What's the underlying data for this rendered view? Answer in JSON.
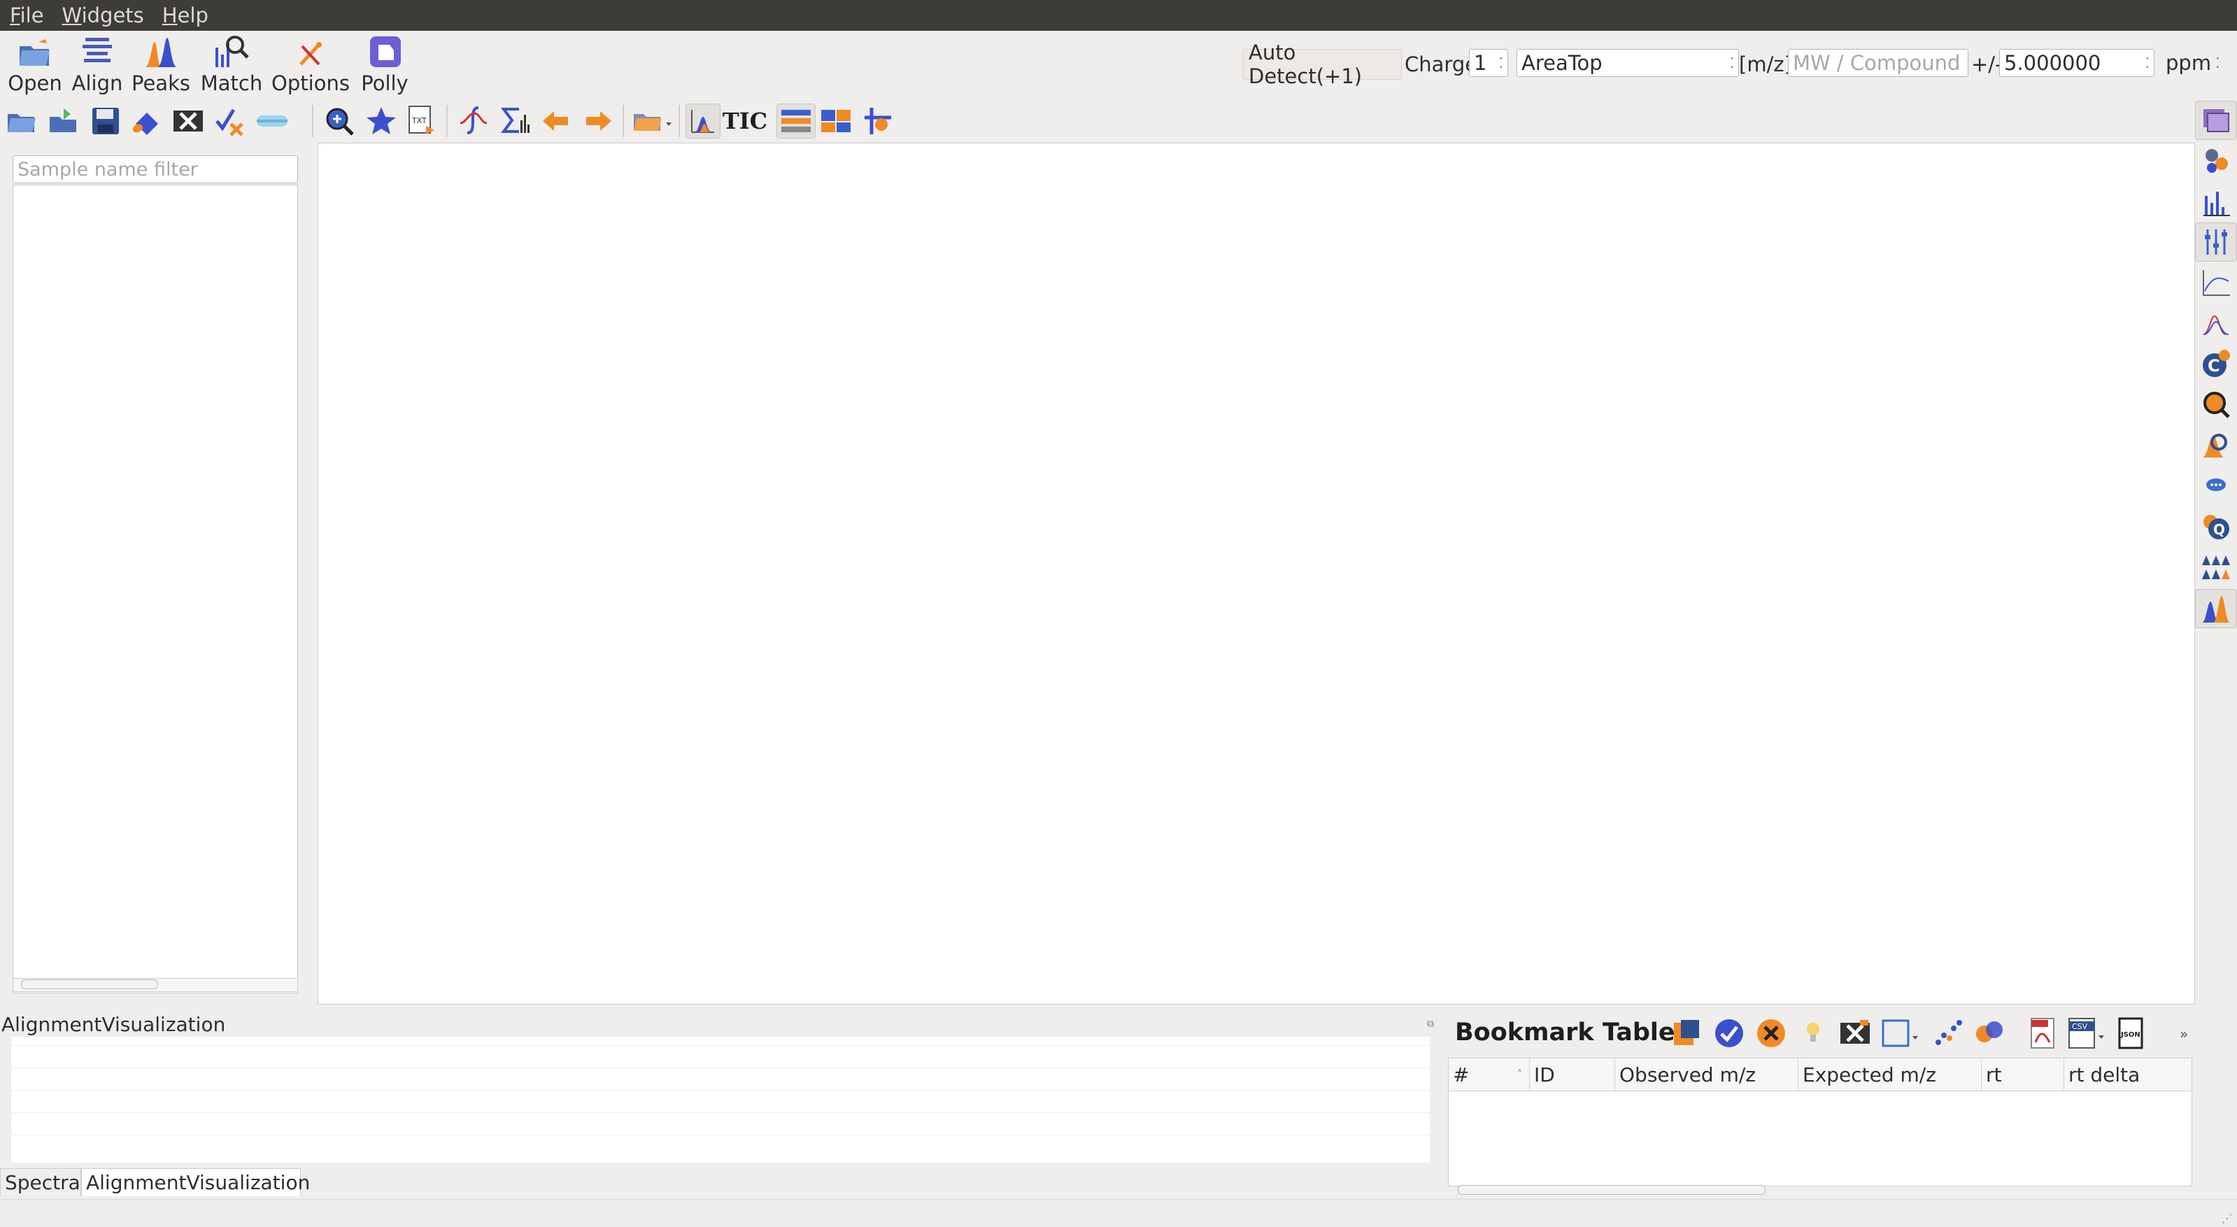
{
  "menu": [
    {
      "mn": "F",
      "rest": "ile"
    },
    {
      "mn": "W",
      "rest": "idgets"
    },
    {
      "mn": "H",
      "rest": "elp"
    }
  ],
  "toolbar": {
    "open": "Open",
    "align": "Align",
    "peaks": "Peaks",
    "match": "Match",
    "options": "Options",
    "polly": "Polly"
  },
  "controls": {
    "auto_detect": "Auto Detect(+1)",
    "charge_label": "Charge",
    "charge_value": "1",
    "quant_type": "AreaTop",
    "mz_label": "[m/z]",
    "compound_placeholder": "MW / Compound",
    "pm_label": "+/-",
    "ppm_value": "5.000000",
    "ppm_unit": "ppm"
  },
  "toolbar2": {
    "tic_label": "TIC"
  },
  "left_panel": {
    "filter_placeholder": "Sample name filter"
  },
  "alignment": {
    "title": "AlignmentVisualization"
  },
  "tabs": [
    "Spectra",
    "AlignmentVisualization"
  ],
  "bookmark": {
    "title": "Bookmark Table",
    "columns": [
      "#",
      "ID",
      "Observed m/z",
      "Expected m/z",
      "rt",
      "rt delta"
    ]
  },
  "colors": {
    "menubar_bg": "#3d3c38",
    "window_bg": "#efeeed",
    "accent_orange": "#f08a24",
    "accent_blue": "#3a5fcd"
  }
}
